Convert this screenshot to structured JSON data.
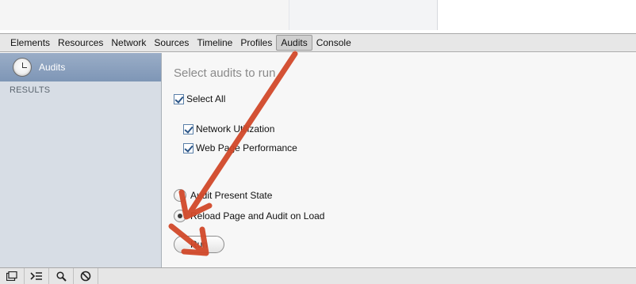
{
  "tabs": [
    "Elements",
    "Resources",
    "Network",
    "Sources",
    "Timeline",
    "Profiles",
    "Audits",
    "Console"
  ],
  "selected_tab": "Audits",
  "sidebar": {
    "item_label": "Audits",
    "item_icon": "clock-icon",
    "results_label": "RESULTS"
  },
  "main": {
    "heading": "Select audits to run",
    "select_all_label": "Select All",
    "select_all_checked": true,
    "audits": [
      {
        "label": "Network Utilization",
        "checked": true
      },
      {
        "label": "Web Page Performance",
        "checked": true
      }
    ],
    "modes": [
      {
        "label": "Audit Present State",
        "selected": false
      },
      {
        "label": "Reload Page and Audit on Load",
        "selected": true
      }
    ],
    "run_label": "Run"
  },
  "statusbar": {
    "icons": [
      "dock-icon",
      "console-drawer-icon",
      "search-icon",
      "clear-icon"
    ]
  },
  "colors": {
    "annotation": "#d2492a",
    "sidebar_selected": "#8aa1bf",
    "sidebar_bg": "#d7dde5"
  }
}
